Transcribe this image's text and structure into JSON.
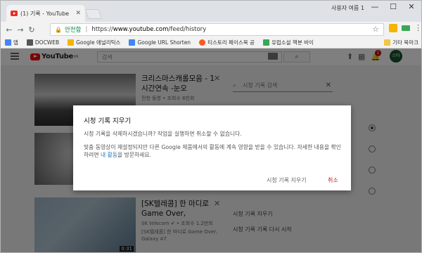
{
  "window": {
    "tab_title": "(1) 기록 - YouTube",
    "user_label": "사용자 여름 1",
    "controls": [
      "—",
      "☐",
      "✕"
    ]
  },
  "address_bar": {
    "secure_label": "안전함",
    "url_scheme": "https://",
    "url_host": "www.youtube.com",
    "url_path": "/feed/history"
  },
  "bookmarks": {
    "items": [
      {
        "label": "앱",
        "color": "#4285f4"
      },
      {
        "label": "DOCWEB",
        "color": "#555555"
      },
      {
        "label": "Google 애널리틱스",
        "color": "#f4b400"
      },
      {
        "label": "Google URL Shorten",
        "color": "#4285f4"
      },
      {
        "label": "티스토리 페이스북 공",
        "color": "#ff5722"
      },
      {
        "label": "유럽소설 책분 바이",
        "color": "#3aa757"
      }
    ],
    "other_label": "기타 북마크"
  },
  "masthead": {
    "logo_text": "YouTube",
    "logo_region": "KR",
    "search_placeholder": "검색",
    "notification_count": "1",
    "avatar_text": "스타"
  },
  "videos": [
    {
      "title": "크리스마스캐롤모음 - 1시간연속 -눈오",
      "meta": "전천 동영 • 조회수 6만회",
      "duration": ""
    },
    {
      "title": "",
      "meta": "",
      "duration": ""
    },
    {
      "title": "[SK텔레콤] 한 마디로 Game Over,",
      "meta": "SK telecom ✔ • 조회수 1.2만회",
      "meta2": "[SK텔레콤] 한 마디로 Game Over, Galaxy A7",
      "duration": "0:31"
    }
  ],
  "history_panel": {
    "search_placeholder": "시청 기록 검색",
    "clear_all": "시청 기록 지우기",
    "pause": "시청 기록 기록 다시 시작"
  },
  "dialog": {
    "title": "시청 기록 지우기",
    "para1": "시청 기록을 삭제하시겠습니까? 작업을 실행하면 취소할 수 없습니다.",
    "para2_a": "맞춤 동영상이 재설정되지만 다른 Google 제품에서의 활동에 계속 영향을 받을 수 있습니다. 자세한 내용을 확인하려면 ",
    "para2_link": "내 활동",
    "para2_b": "을 방문하세요.",
    "clear_button": "시청 기록 지우기",
    "cancel_button": "취소"
  }
}
